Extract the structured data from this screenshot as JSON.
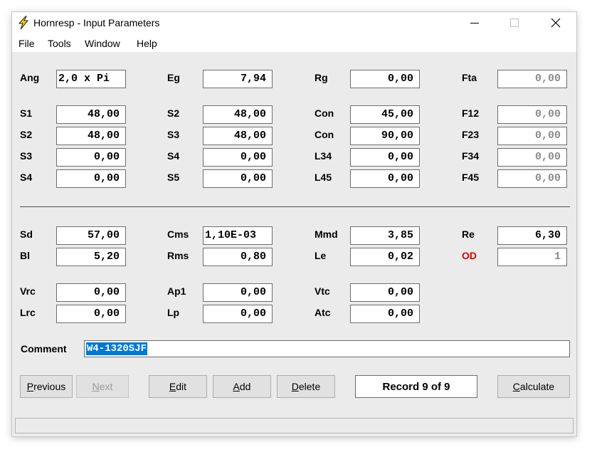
{
  "title": "Hornresp - Input Parameters",
  "menu": [
    "File",
    "Tools",
    "Window",
    "Help"
  ],
  "row_ang": {
    "ang": "Ang",
    "ang_val": "2,0 x Pi",
    "eg": "Eg",
    "eg_val": "7,94",
    "rg": "Rg",
    "rg_val": "0,00",
    "fta": "Fta",
    "fta_val": "0,00"
  },
  "horn": [
    {
      "a": "S1",
      "av": "48,00",
      "b": "S2",
      "bv": "48,00",
      "c": "Con",
      "cv": "45,00",
      "d": "F12",
      "dv": "0,00"
    },
    {
      "a": "S2",
      "av": "48,00",
      "b": "S3",
      "bv": "48,00",
      "c": "Con",
      "cv": "90,00",
      "d": "F23",
      "dv": "0,00"
    },
    {
      "a": "S3",
      "av": "0,00",
      "b": "S4",
      "bv": "0,00",
      "c": "L34",
      "cv": "0,00",
      "d": "F34",
      "dv": "0,00"
    },
    {
      "a": "S4",
      "av": "0,00",
      "b": "S5",
      "bv": "0,00",
      "c": "L45",
      "cv": "0,00",
      "d": "F45",
      "dv": "0,00"
    }
  ],
  "driver": [
    {
      "a": "Sd",
      "av": "57,00",
      "b": "Cms",
      "bv": "1,10E-03",
      "c": "Mmd",
      "cv": "3,85",
      "d": "Re",
      "dv": "6,30"
    },
    {
      "a": "Bl",
      "av": "5,20",
      "b": "Rms",
      "bv": "0,80",
      "c": "Le",
      "cv": "0,02",
      "d": "OD",
      "dv": "1"
    }
  ],
  "chamber": [
    {
      "a": "Vrc",
      "av": "0,00",
      "b": "Ap1",
      "bv": "0,00",
      "c": "Vtc",
      "cv": "0,00"
    },
    {
      "a": "Lrc",
      "av": "0,00",
      "b": "Lp",
      "bv": "0,00",
      "c": "Atc",
      "cv": "0,00"
    }
  ],
  "comment": {
    "label": "Comment",
    "value": "W4-1320SJF"
  },
  "buttons": {
    "previous": {
      "key": "P",
      "rest": "revious"
    },
    "next": {
      "key": "N",
      "rest": "ext"
    },
    "edit": {
      "key": "E",
      "rest": "dit"
    },
    "add": {
      "key": "A",
      "rest": "dd"
    },
    "delete": {
      "key": "D",
      "rest": "elete"
    },
    "calculate": {
      "key": "C",
      "rest": "alculate"
    }
  },
  "record": "Record 9 of 9",
  "colors": {
    "od_label": "#dd0000",
    "selection": "#0078d7"
  }
}
